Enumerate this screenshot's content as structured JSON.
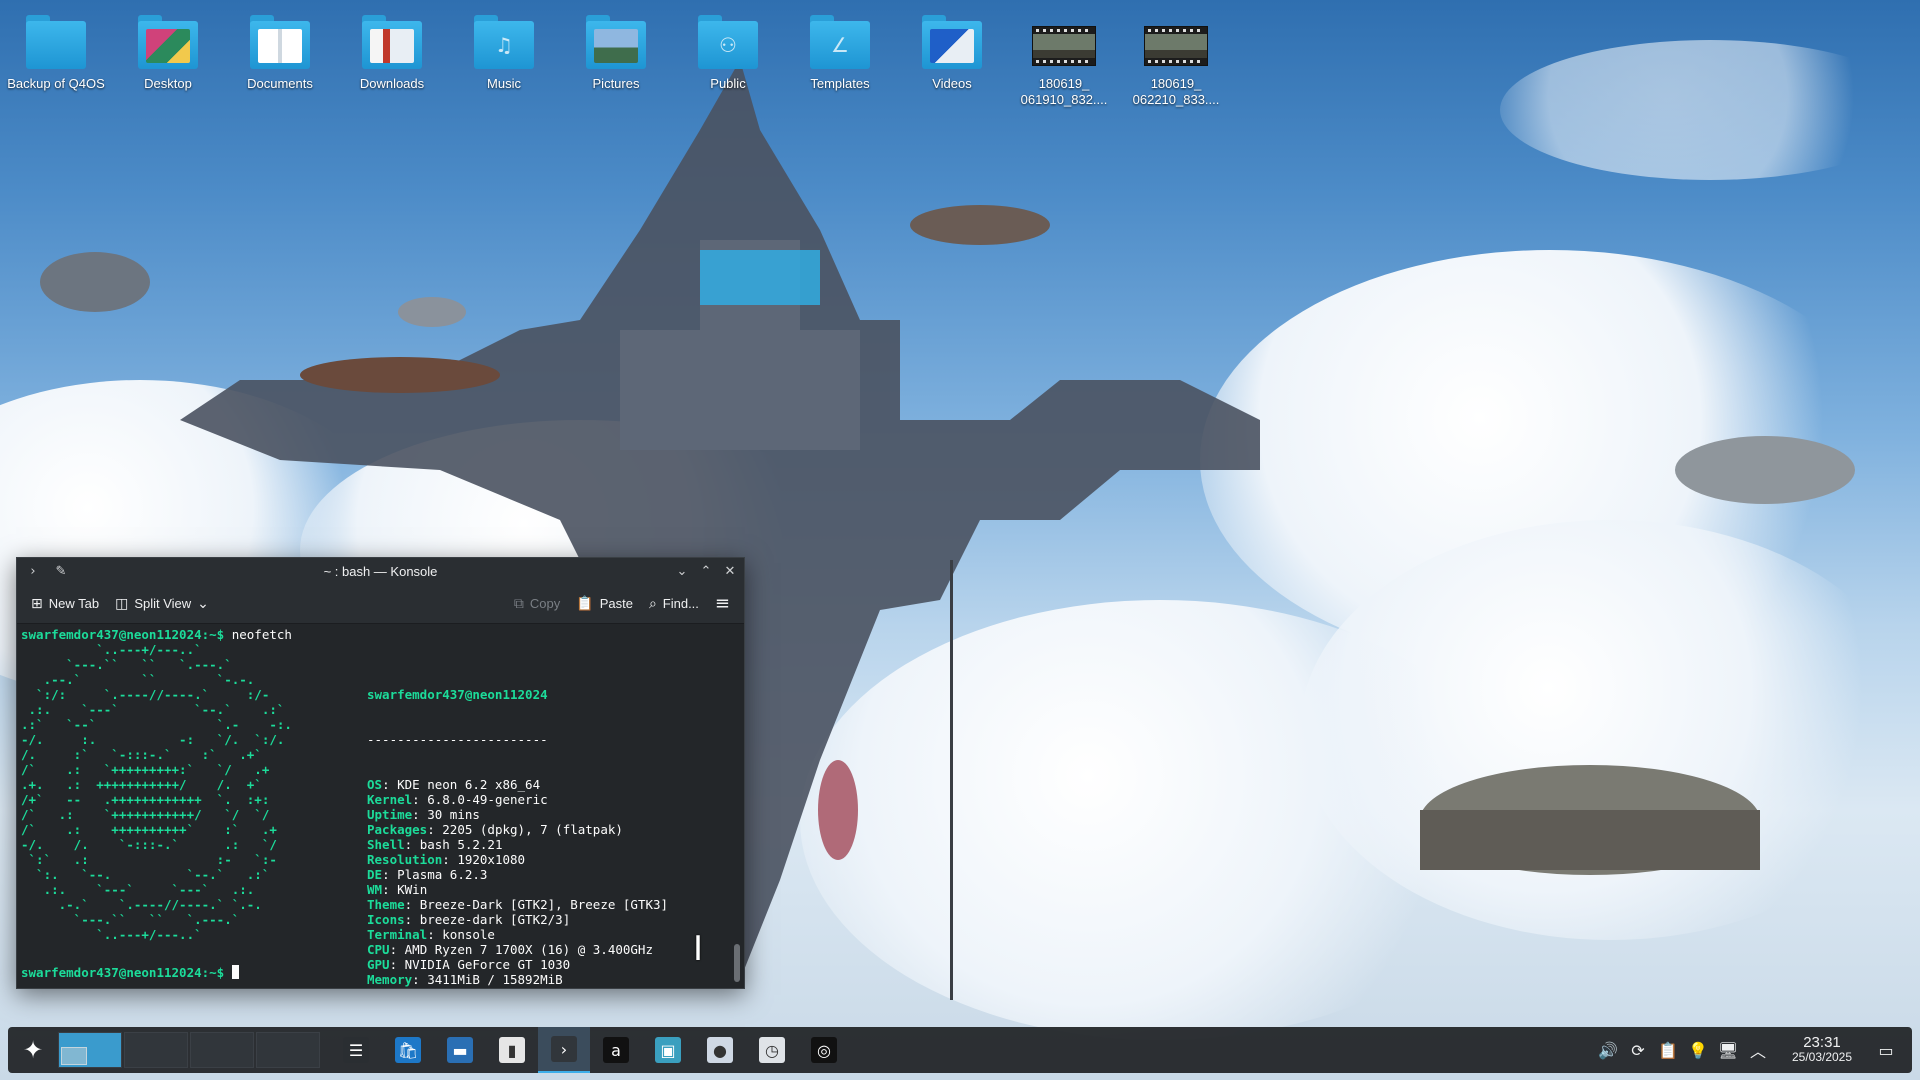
{
  "desktop": {
    "icons": [
      {
        "label": "Backup of Q4OS",
        "kind": "folder",
        "emblem": ""
      },
      {
        "label": "Desktop",
        "kind": "folder-preview",
        "emblem": ""
      },
      {
        "label": "Documents",
        "kind": "folder-preview",
        "emblem": ""
      },
      {
        "label": "Downloads",
        "kind": "folder-preview",
        "emblem": ""
      },
      {
        "label": "Music",
        "kind": "folder",
        "emblem": "♫"
      },
      {
        "label": "Pictures",
        "kind": "folder-preview",
        "emblem": ""
      },
      {
        "label": "Public",
        "kind": "folder",
        "emblem": "⚇"
      },
      {
        "label": "Templates",
        "kind": "folder",
        "emblem": "∠"
      },
      {
        "label": "Videos",
        "kind": "folder-preview",
        "emblem": ""
      },
      {
        "label": "180619_\n061910_832....",
        "kind": "video-file",
        "emblem": ""
      },
      {
        "label": "180619_\n062210_833....",
        "kind": "video-file",
        "emblem": ""
      }
    ]
  },
  "konsole": {
    "title": "~ : bash — Konsole",
    "toolbar": {
      "new_tab": "New Tab",
      "split_view": "Split View",
      "copy": "Copy",
      "paste": "Paste",
      "find": "Find..."
    },
    "prompt": "swarfemdor437@neon112024:~$",
    "command": "neofetch",
    "ascii_art": "          `..---+/---..`\n      `---.``   ``   `.---.`\n   .--.`        ``        `-.-.\n  `:/:     `.----//----.`     :/-\n .:.    `---`          `--.`    .:`\n.:`   `--`                `.-    -:.\n-/.     :.           -:   `/.  `:/.\n/.     :`   `-:::-.`    :`   .+`\n/`    .:   `+++++++++:`   `/   .+\n.+.   .:  +++++++++++/    /.  +`\n/+`   --   .++++++++++++  `.  :+:\n/`   .:    `+++++++++++/   `/  `/\n/`    .:    ++++++++++`    :`   .+\n-/.    /.    `-:::-.`      .:   `/\n `:`   .:                 :-   `:-\n  `:.   `--.          `--.`   .:`\n   .:.    `---`     `---`   .:.\n     .-.`    `.----//----.` `.-.\n       `---.``   ``   `.---.`\n          `..---+/---..`",
    "neofetch": {
      "user_host": "swarfemdor437@neon112024",
      "separator": "------------------------",
      "fields": [
        {
          "key": "OS",
          "value": "KDE neon 6.2 x86_64"
        },
        {
          "key": "Kernel",
          "value": "6.8.0-49-generic"
        },
        {
          "key": "Uptime",
          "value": "30 mins"
        },
        {
          "key": "Packages",
          "value": "2205 (dpkg), 7 (flatpak)"
        },
        {
          "key": "Shell",
          "value": "bash 5.2.21"
        },
        {
          "key": "Resolution",
          "value": "1920x1080"
        },
        {
          "key": "DE",
          "value": "Plasma 6.2.3"
        },
        {
          "key": "WM",
          "value": "KWin"
        },
        {
          "key": "Theme",
          "value": "Breeze-Dark [GTK2], Breeze [GTK3]"
        },
        {
          "key": "Icons",
          "value": "breeze-dark [GTK2/3]"
        },
        {
          "key": "Terminal",
          "value": "konsole"
        },
        {
          "key": "CPU",
          "value": "AMD Ryzen 7 1700X (16) @ 3.400GHz"
        },
        {
          "key": "GPU",
          "value": "NVIDIA GeForce GT 1030"
        },
        {
          "key": "Memory",
          "value": "3411MiB / 15892MiB"
        }
      ],
      "palette": [
        "#555555",
        "#e0202a",
        "#1ec36a",
        "#f59a1d",
        "#2f95df",
        "#9b4bc2",
        "#13a98e",
        "#ffffff"
      ]
    }
  },
  "taskbar": {
    "tasks": [
      {
        "name": "system-settings",
        "glyph": "☰",
        "bg": "#2a2e32"
      },
      {
        "name": "discover-store",
        "glyph": "🛍",
        "bg": "#1d78c8"
      },
      {
        "name": "file-manager",
        "glyph": "▬",
        "bg": "#2a6fb4"
      },
      {
        "name": "text-editor",
        "glyph": "▮",
        "bg": "#e6e6e6"
      },
      {
        "name": "konsole",
        "glyph": "›",
        "bg": "#31363b"
      },
      {
        "name": "app-a",
        "glyph": "a",
        "bg": "#111111"
      },
      {
        "name": "image-viewer",
        "glyph": "▣",
        "bg": "#3a9fbf"
      },
      {
        "name": "disc-app",
        "glyph": "●",
        "bg": "#cfd8e4"
      },
      {
        "name": "calendar-app",
        "glyph": "◷",
        "bg": "#dfe3e7"
      },
      {
        "name": "spiral-app",
        "glyph": "◎",
        "bg": "#111111"
      }
    ],
    "tray": [
      {
        "name": "volume-icon",
        "glyph": "🔊"
      },
      {
        "name": "update-icon",
        "glyph": "⟳"
      },
      {
        "name": "clipboard-icon",
        "glyph": "📋"
      },
      {
        "name": "bulb-icon",
        "glyph": "💡"
      },
      {
        "name": "network-icon",
        "glyph": "🖥"
      },
      {
        "name": "expand-tray-icon",
        "glyph": "︿"
      }
    ],
    "clock": {
      "time": "23:31",
      "date": "25/03/2025"
    }
  }
}
